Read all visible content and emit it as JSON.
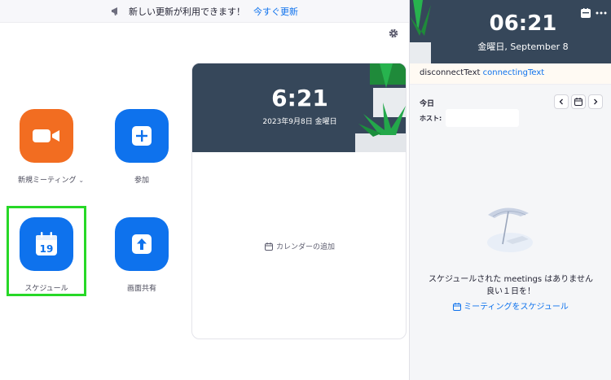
{
  "banner": {
    "message": "新しい更新が利用できます！",
    "link": "今すぐ更新"
  },
  "home": {
    "new_meeting": "新規ミーティング",
    "join": "参加",
    "schedule": "スケジュール",
    "calendar_day": "19",
    "share_screen": "画面共有"
  },
  "card": {
    "time": "6:21",
    "date": "2023年9月8日 金曜日",
    "add_calendar": "カレンダーの追加"
  },
  "panel": {
    "time": "06:21",
    "date": "金曜日, September 8",
    "status_disconnect": "disconnectText",
    "status_connecting": "connectingText",
    "today": "今日",
    "host_label": "ホスト:",
    "empty_line1": "スケジュールされた meetings はありません",
    "empty_line2": "良い１日を！",
    "schedule_link": "ミーティングをスケジュール"
  },
  "colors": {
    "accent": "#0e72ed",
    "orange": "#f26d21",
    "header": "#36475a",
    "highlight": "#27d827"
  },
  "icons": {
    "banner": "megaphone-icon",
    "settings": "gear-icon",
    "new_meeting": "video-camera-icon",
    "join": "plus-icon",
    "schedule": "calendar-icon",
    "share": "arrow-up-icon"
  }
}
